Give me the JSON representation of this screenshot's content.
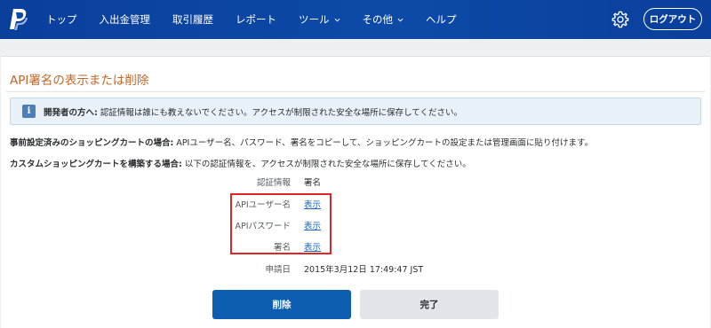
{
  "nav": {
    "items": [
      {
        "label": "トップ",
        "dropdown": false
      },
      {
        "label": "入出金管理",
        "dropdown": false
      },
      {
        "label": "取引履歴",
        "dropdown": false
      },
      {
        "label": "レポート",
        "dropdown": false
      },
      {
        "label": "ツール",
        "dropdown": true
      },
      {
        "label": "その他",
        "dropdown": true
      },
      {
        "label": "ヘルプ",
        "dropdown": false
      }
    ],
    "logout_label": "ログアウト",
    "icons": {
      "logo": "paypal-logo",
      "settings": "gear-icon",
      "dropdown": "chevron-down-icon"
    }
  },
  "page": {
    "title": "API署名の表示または削除"
  },
  "notice": {
    "icon": "info-icon",
    "icon_glyph": "i",
    "lead": "開発者の方へ:",
    "text": " 認証情報は誰にも教えないでください。アクセスが制限された安全な場所に保存してください。"
  },
  "paragraphs": [
    {
      "lead": "事前設定済みのショッピングカートの場合:",
      "text": " APIユーザー名、パスワード、署名をコピーして、ショッピングカートの設定または管理画面に貼り付けます。"
    },
    {
      "lead": "カスタムショッピングカートを構築する場合:",
      "text": " 以下の認証情報を、アクセスが制限された安全な場所に保存してください。"
    }
  ],
  "credentials": {
    "header_label": "認証情報",
    "header_value": "署名",
    "rows": [
      {
        "label": "APIユーザー名",
        "link": "表示"
      },
      {
        "label": "APIパスワード",
        "link": "表示"
      },
      {
        "label": "署名",
        "link": "表示"
      }
    ],
    "date_label": "申請日",
    "date_value": "2015年3月12日 17:49:47 JST"
  },
  "buttons": {
    "delete": "削除",
    "done": "完了"
  },
  "colors": {
    "nav_bg": "#0d4aa8",
    "title": "#c0672b",
    "link": "#1f66b8",
    "primary_button": "#0d5db1",
    "highlight_box": "#e12424"
  }
}
